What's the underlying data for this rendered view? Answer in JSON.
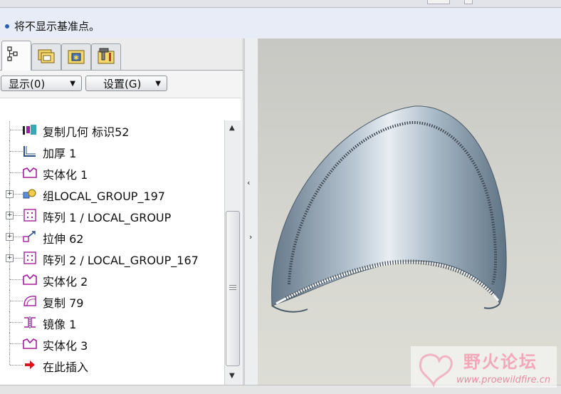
{
  "message": {
    "text": "将不显示基准点。"
  },
  "toolbar": {
    "show_label": "显示(0)",
    "settings_label": "设置(G)"
  },
  "tree": {
    "items": [
      {
        "label": "复制几何 标识52",
        "icon": "copy-geometry-icon",
        "expandable": false
      },
      {
        "label": "加厚 1",
        "icon": "thicken-icon",
        "expandable": false
      },
      {
        "label": "实体化 1",
        "icon": "solidify-icon",
        "expandable": false
      },
      {
        "label": "组LOCAL_GROUP_197",
        "icon": "group-icon",
        "expandable": true
      },
      {
        "label": "阵列 1 / LOCAL_GROUP",
        "icon": "pattern-icon",
        "expandable": true
      },
      {
        "label": "拉伸 62",
        "icon": "extrude-icon",
        "expandable": true
      },
      {
        "label": "阵列 2 / LOCAL_GROUP_167",
        "icon": "pattern-icon",
        "expandable": true
      },
      {
        "label": "实体化 2",
        "icon": "solidify-icon",
        "expandable": false
      },
      {
        "label": "复制 79",
        "icon": "copy-surface-icon",
        "expandable": false
      },
      {
        "label": "镜像 1",
        "icon": "mirror-icon",
        "expandable": false
      },
      {
        "label": "实体化 3",
        "icon": "solidify-icon",
        "expandable": false
      },
      {
        "label": "在此插入",
        "icon": "insert-here-arrow-icon",
        "expandable": false
      }
    ]
  },
  "watermark": {
    "title": "野火论坛",
    "url": "www.proewildfire.cn"
  },
  "colors": {
    "accent": "#2a5fb8",
    "part_surface": "#9fb0be",
    "icon_magenta": "#a3209c"
  }
}
